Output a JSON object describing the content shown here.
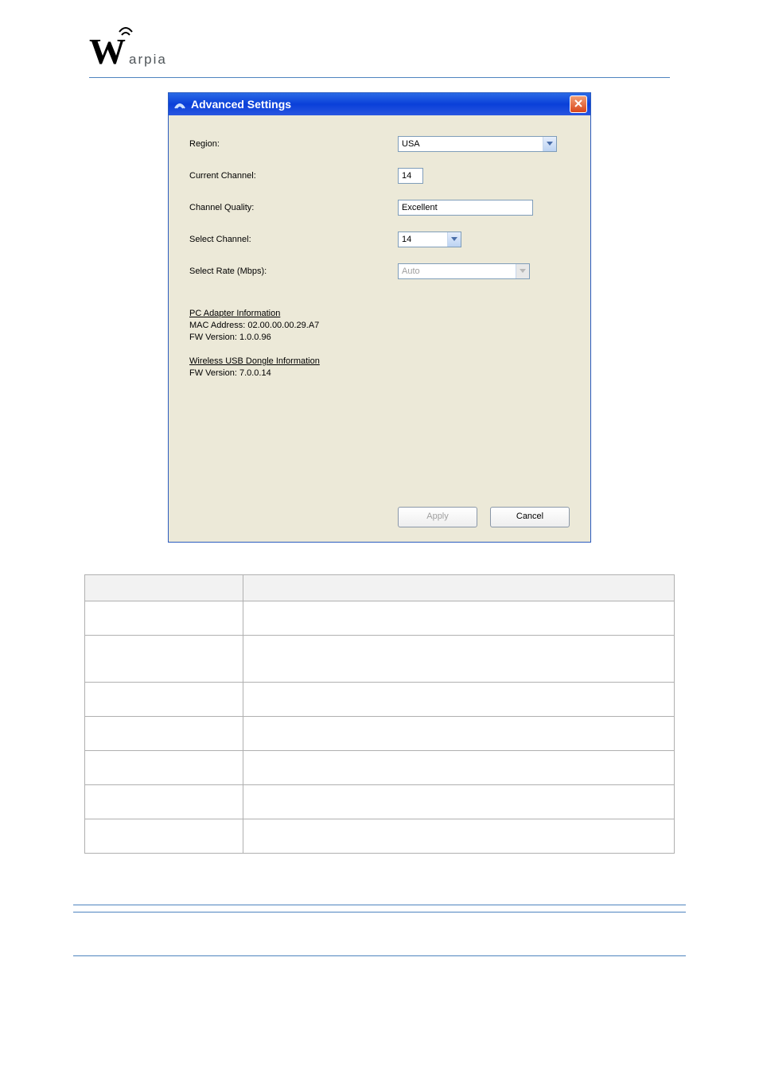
{
  "brand": "Warpia",
  "dialog": {
    "title": "Advanced Settings",
    "close": "✕",
    "region": {
      "label": "Region:",
      "value": "USA"
    },
    "current_channel": {
      "label": "Current Channel:",
      "value": "14"
    },
    "channel_quality": {
      "label": "Channel Quality:",
      "value": "Excellent"
    },
    "select_channel": {
      "label": "Select Channel:",
      "value": "14"
    },
    "select_rate": {
      "label": "Select Rate (Mbps):",
      "value": "Auto"
    },
    "pc_adapter": {
      "heading": "PC Adapter Information",
      "mac": "MAC Address: 02.00.00.00.29.A7",
      "fw": "FW Version: 1.0.0.96"
    },
    "dongle": {
      "heading": "Wireless USB Dongle Information",
      "fw": "FW Version: 7.0.0.14"
    },
    "apply": "Apply",
    "cancel": "Cancel"
  }
}
